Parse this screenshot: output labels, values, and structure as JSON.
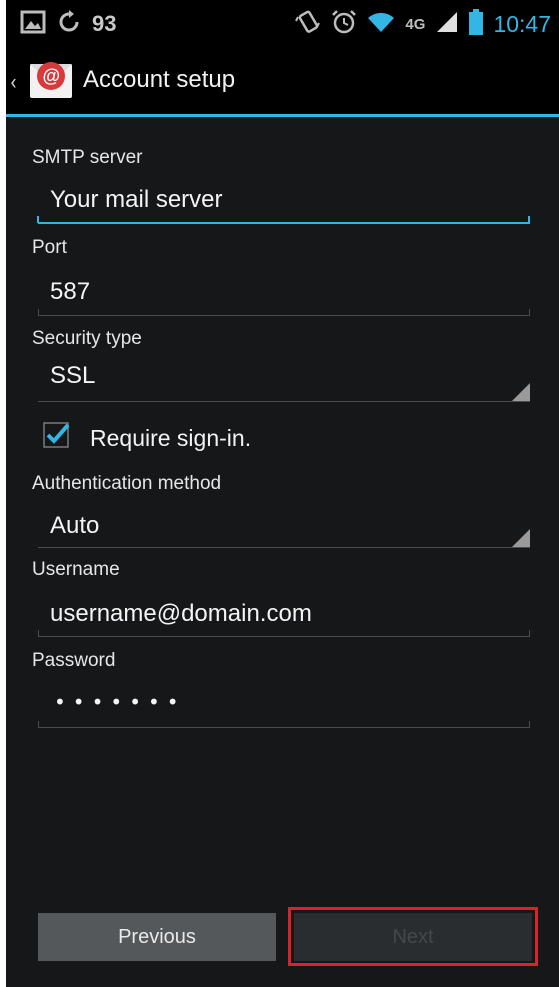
{
  "status_bar": {
    "left_count": "93",
    "network_label": "4G",
    "time": "10:47"
  },
  "action_bar": {
    "title": "Account setup"
  },
  "form": {
    "smtp": {
      "label": "SMTP server",
      "value": "Your mail server"
    },
    "port": {
      "label": "Port",
      "value": "587"
    },
    "security": {
      "label": "Security type",
      "value": "SSL"
    },
    "require_signin": {
      "label": "Require sign-in.",
      "checked": true
    },
    "auth": {
      "label": "Authentication method",
      "value": "Auto"
    },
    "username": {
      "label": "Username",
      "value": "username@domain.com"
    },
    "password": {
      "label": "Password",
      "value": "•••••••"
    }
  },
  "buttons": {
    "previous": "Previous",
    "next": "Next"
  },
  "colors": {
    "accent": "#33b5e5",
    "highlight": "#d9222a"
  },
  "icons": {
    "image": "image-icon",
    "sync": "sync-icon",
    "vibrate": "vibrate-icon",
    "alarm": "alarm-icon",
    "wifi": "wifi-icon",
    "signal": "signal-icon",
    "battery": "battery-icon",
    "app": "email-app-icon",
    "back": "chevron-left-icon",
    "check": "checkbox-checked-icon"
  }
}
